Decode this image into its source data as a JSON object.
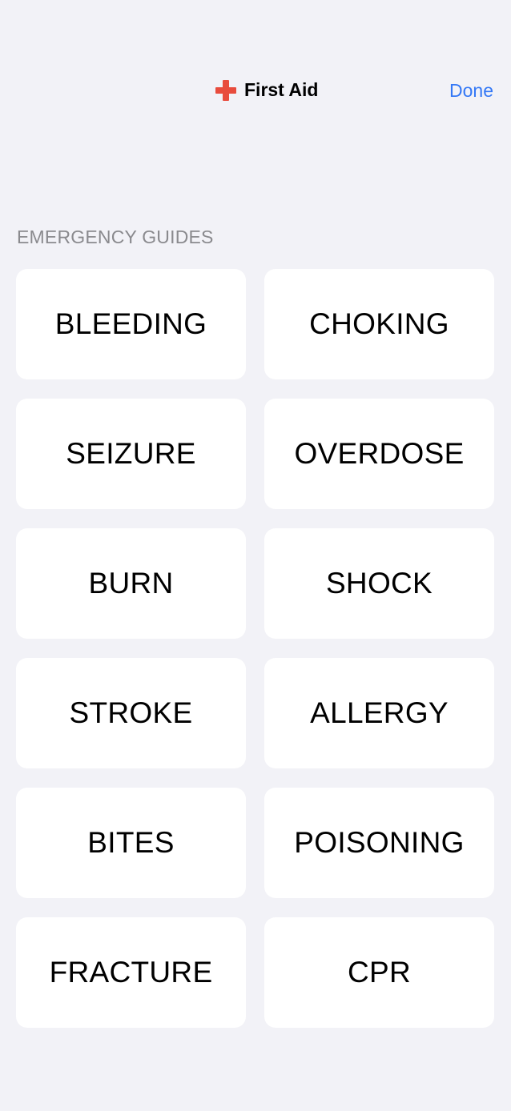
{
  "nav": {
    "title": "First Aid",
    "icon": "red-cross-icon",
    "done_label": "Done"
  },
  "section": {
    "header": "EMERGENCY GUIDES"
  },
  "guides": [
    {
      "label": "BLEEDING"
    },
    {
      "label": "CHOKING"
    },
    {
      "label": "SEIZURE"
    },
    {
      "label": "OVERDOSE"
    },
    {
      "label": "BURN"
    },
    {
      "label": "SHOCK"
    },
    {
      "label": "STROKE"
    },
    {
      "label": "ALLERGY"
    },
    {
      "label": "BITES"
    },
    {
      "label": "POISONING"
    },
    {
      "label": "FRACTURE"
    },
    {
      "label": "CPR"
    }
  ],
  "colors": {
    "background": "#f2f2f7",
    "accent": "#3478f6",
    "cross": "#e84c3d",
    "section_header": "#8a8a8e"
  }
}
